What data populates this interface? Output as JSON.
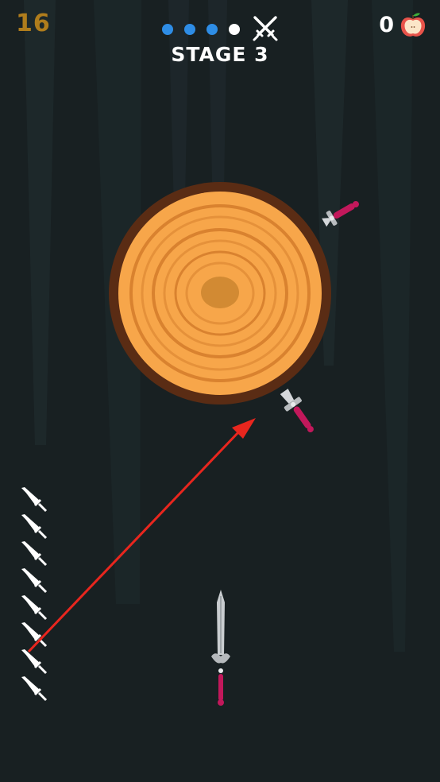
{
  "hud": {
    "score": "16",
    "stage_label": "STAGE 3",
    "apple_count": "0",
    "stage_progress": [
      "done",
      "done",
      "done",
      "current"
    ],
    "boss_icon": "crossed-swords-icon",
    "apple_icon": "apple-icon"
  },
  "game": {
    "target": "wooden-log-target",
    "stuck_knives": 2,
    "remaining_knives": 8,
    "ready_knife": "sword"
  },
  "colors": {
    "background": "#182022",
    "score": "#b07d1c",
    "stage_dot_done": "#2e8de6",
    "stage_dot_current": "#ffffff",
    "wood_rim": "#5a2c14",
    "wood_face": "#f7a64a",
    "aim_arrow": "#e8261e"
  }
}
